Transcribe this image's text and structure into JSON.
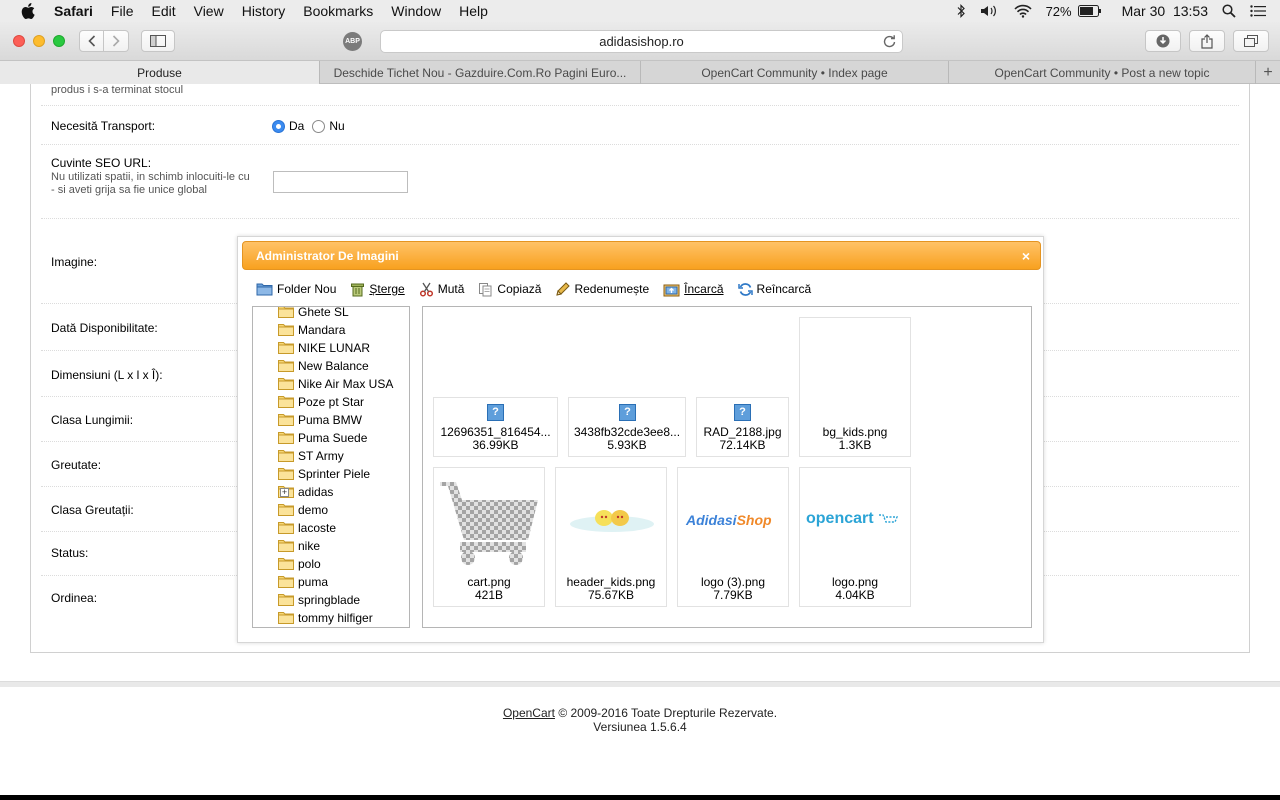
{
  "menubar": {
    "app": "Safari",
    "items": [
      "File",
      "Edit",
      "View",
      "History",
      "Bookmarks",
      "Window",
      "Help"
    ],
    "battery": "72%",
    "datetime": "Mar 30  13:53"
  },
  "toolbar": {
    "url": "adidasishop.ro",
    "abp": "ABP"
  },
  "tabs": [
    {
      "label": "Produse"
    },
    {
      "label": "Deschide Tichet Nou - Gazduire.Com.Ro Pagini Euro..."
    },
    {
      "label": "OpenCart Community • Index page"
    },
    {
      "label": "OpenCart Community • Post a new topic"
    },
    {
      "label": "+"
    }
  ],
  "form": {
    "stock_help_tail": "produs i s-a terminat stocul",
    "shipping_label": "Necesită Transport:",
    "shipping_yes": "Da",
    "shipping_no": "Nu",
    "seo_label": "Cuvinte SEO URL:",
    "seo_help": "Nu utilizati spatii, in schimb inlocuiti-le cu - si aveti grija sa fie unice global",
    "seo_value": "",
    "image_label": "Imagine:",
    "availability_label": "Dată Disponibilitate:",
    "dimensions_label": "Dimensiuni (L x l x Î):",
    "length_class_label": "Clasa Lungimii:",
    "weight_label": "Greutate:",
    "weight_class_label": "Clasa Greutații:",
    "status_label": "Status:",
    "sort_label": "Ordinea:"
  },
  "dialog": {
    "title": "Administrator De Imagini",
    "close": "×",
    "tools": [
      "Folder Nou",
      "Șterge",
      "Mută",
      "Copiază",
      "Redenumește",
      "Încarcă",
      "Reîncarcă"
    ],
    "folders": [
      "Ghete SL",
      "Mandara",
      "NIKE LUNAR",
      "New Balance",
      "Nike Air Max USA",
      "Poze pt Star",
      "Puma BMW",
      "Puma Suede",
      "ST Army",
      "Sprinter Piele",
      "adidas",
      "demo",
      "lacoste",
      "nike",
      "polo",
      "puma",
      "springblade",
      "tommy hilfiger"
    ],
    "files": [
      {
        "name": "12696351_816454...",
        "size": "36.99KB"
      },
      {
        "name": "3438fb32cde3ee8...",
        "size": "5.93KB"
      },
      {
        "name": "RAD_2188.jpg",
        "size": "72.14KB"
      },
      {
        "name": "bg_kids.png",
        "size": "1.3KB"
      },
      {
        "name": "cart.png",
        "size": "421B"
      },
      {
        "name": "header_kids.png",
        "size": "75.67KB"
      },
      {
        "name": "logo (3).png",
        "size": "7.79KB"
      },
      {
        "name": "logo.png",
        "size": "4.04KB"
      }
    ],
    "logo_text_adidasi": "Adidasi",
    "logo_text_shop": "Shop",
    "logo_text_opencart": "opencart"
  },
  "footer": {
    "link": "OpenCart",
    "copyright": "© 2009-2016 Toate Drepturile Rezervate.",
    "version": "Versiunea 1.5.6.4"
  }
}
